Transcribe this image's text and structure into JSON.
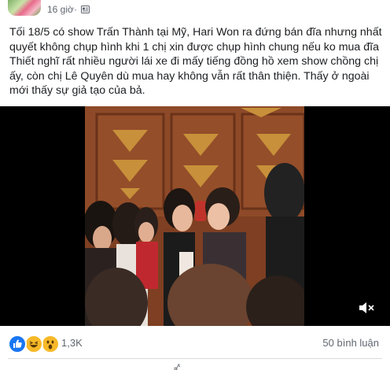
{
  "post": {
    "timestamp": "16 giờ",
    "separator": "·",
    "audience_icon": "public-audience-icon",
    "text": "Tối 18/5 có show Trấn Thành tại Mỹ, Hari Won ra đứng bán đĩa nhưng nhất quyết không chụp hình khi 1 chị xin được chụp hình chung nếu ko mua đĩa Thiết nghĩ rất nhiều người lái xe đi mấy tiếng đồng hồ xem show chồng chị ấy, còn chị Lê Quyên dù mua hay không vẫn rất thân thiện. Thấy ở ngoài mới thấy sự giả tạo của bả."
  },
  "video": {
    "mute_icon": "volume-muted-icon"
  },
  "footer": {
    "reactions": [
      "like-reaction-icon",
      "haha-reaction-icon",
      "wow-reaction-icon"
    ],
    "reaction_count": "1,3K",
    "comment_count": "50 bình luận"
  },
  "colors": {
    "like_blue": "#1877f2",
    "emoji_yellow": "#f7b928",
    "meta_gray": "#606770",
    "wall_red": "#8a4a2a",
    "triangle_gold": "#c8903a"
  }
}
